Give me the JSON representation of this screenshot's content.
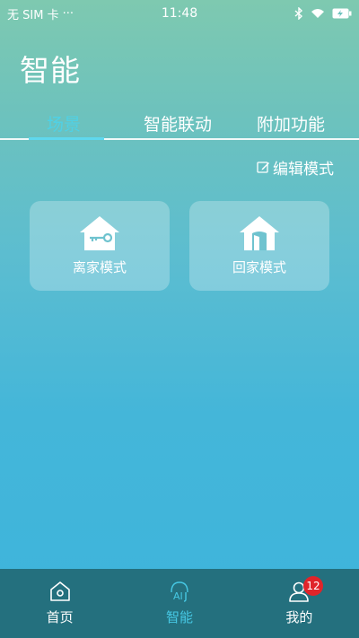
{
  "status_bar": {
    "carrier": "无 SIM 卡",
    "more": "···",
    "time": "11:48",
    "icons": [
      "bluetooth-icon",
      "wifi-icon",
      "battery-charging-icon"
    ]
  },
  "header": {
    "title": "智能"
  },
  "tabs": [
    {
      "label": "场景",
      "active": true
    },
    {
      "label": "智能联动",
      "active": false
    },
    {
      "label": "附加功能",
      "active": false
    }
  ],
  "edit_mode": {
    "label": "编辑模式",
    "icon": "edit-icon"
  },
  "scenes": [
    {
      "label": "离家模式",
      "icon": "house-key-icon"
    },
    {
      "label": "回家模式",
      "icon": "house-door-icon"
    }
  ],
  "bottom_nav": [
    {
      "label": "首页",
      "icon": "home-icon",
      "active": false
    },
    {
      "label": "智能",
      "icon": "ai-icon",
      "icon_text": "AI",
      "active": true
    },
    {
      "label": "我的",
      "icon": "user-icon",
      "active": false,
      "badge": "12"
    }
  ],
  "colors": {
    "active_tab": "#4fd1e6",
    "nav_background": "#24707e",
    "badge": "#e0242a"
  }
}
